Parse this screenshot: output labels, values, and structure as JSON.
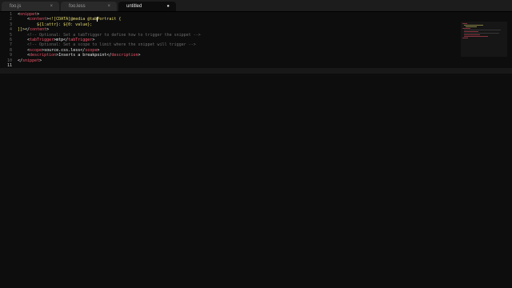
{
  "tabs": [
    {
      "label": "foo.js",
      "close": "×"
    },
    {
      "label": "foo.less",
      "close": "×"
    },
    {
      "label": "untitled",
      "close": "●"
    }
  ],
  "line_numbers": [
    "1",
    "2",
    "3",
    "4",
    "5",
    "6",
    "7",
    "8",
    "9",
    "10",
    "11"
  ],
  "code": {
    "l1_tag": "snippet",
    "l2_tag": "content",
    "l2_cdata": "<![CDATA[@media @tab",
    "l2_rest": "Portrait {",
    "l3_text": "${1:attr}: ${0: value};",
    "l4_close": "]]>",
    "l4_tag": "content",
    "l5_comment": "<!-- Optional: Set a tabTrigger to define how to trigger the snippet -->",
    "l6_tag": "tabTrigger",
    "l6_value": "mtp",
    "l7_comment": "<!-- Optional: Set a scope to limit where the snippet will trigger -->",
    "l8_tag": "scope",
    "l8_value": "source.css.less",
    "l9_tag": "description",
    "l9_value": "Inserts a breakpoint",
    "l10_tag": "snippet"
  },
  "colors": {
    "background": "#0d0d0d",
    "tag": "#f0556a",
    "string": "#e6db74",
    "comment": "#6b6b6b",
    "text": "#e8e8e8"
  }
}
